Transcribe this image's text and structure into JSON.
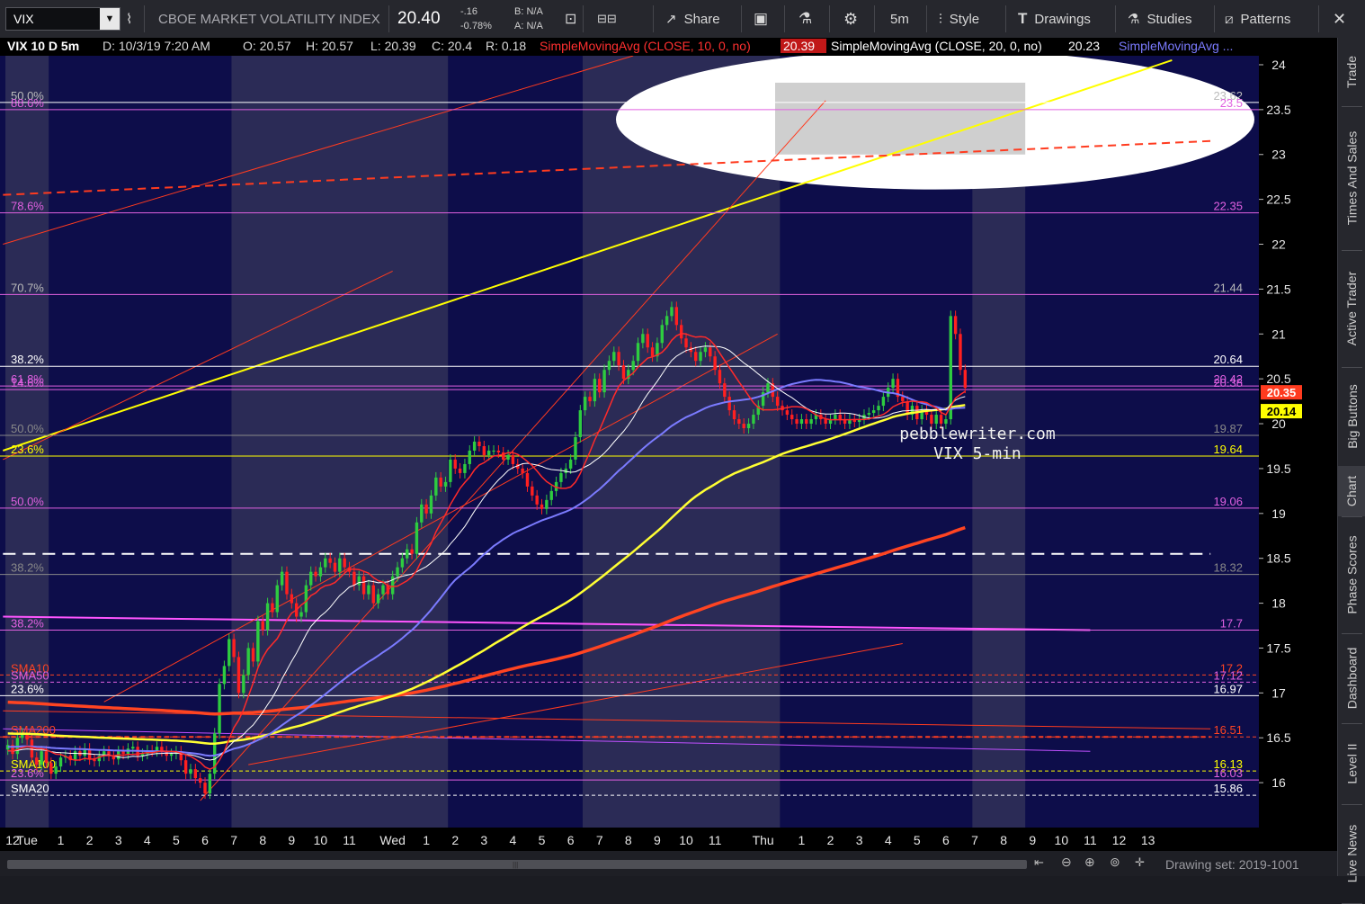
{
  "toolbar": {
    "symbol": "VIX",
    "name": "CBOE MARKET VOLATILITY INDEX",
    "last": "20.40",
    "change": "-.16",
    "change_pct": "-0.78%",
    "bid": "B: N/A",
    "ask": "A: N/A",
    "share": "Share",
    "timeframe": "5m",
    "style": "Style",
    "drawings": "Drawings",
    "studies": "Studies",
    "patterns": "Patterns"
  },
  "info": {
    "title": "VIX 10 D 5m",
    "date": "D: 10/3/19 7:20 AM",
    "open": "O: 20.57",
    "high": "H: 20.57",
    "low": "L: 20.39",
    "close": "C: 20.4",
    "range": "R: 0.18",
    "sma1": "SimpleMovingAvg (CLOSE, 10, 0, no)",
    "sma1_val": "20.39",
    "sma2": "SimpleMovingAvg (CLOSE, 20, 0, no)",
    "sma2_val": "20.23",
    "sma3": "SimpleMovingAvg ..."
  },
  "rightnav": [
    "Trade",
    "Times And Sales",
    "Active Trader",
    "Big Buttons",
    "Chart",
    "Phase Scores",
    "Dashboard",
    "Level II",
    "Live News"
  ],
  "watermark": {
    "line1": "pebblewriter.com",
    "line2": "VIX 5-min"
  },
  "bottom": {
    "drawing_set": "Drawing set: 2019-1001"
  },
  "chart_data": {
    "type": "candlestick",
    "symbol": "VIX",
    "interval": "5m",
    "ylim": [
      15.5,
      24.1
    ],
    "y_ticks": [
      16,
      16.5,
      17,
      17.5,
      18,
      18.5,
      19,
      19.5,
      20,
      20.5,
      21,
      21.5,
      22,
      22.5,
      23,
      23.5,
      24
    ],
    "x_ticks": [
      {
        "i": 1,
        "label": "12"
      },
      {
        "i": 4,
        "label": "Tue"
      },
      {
        "i": 11,
        "label": "1"
      },
      {
        "i": 17,
        "label": "2"
      },
      {
        "i": 23,
        "label": "3"
      },
      {
        "i": 29,
        "label": "4"
      },
      {
        "i": 35,
        "label": "5"
      },
      {
        "i": 41,
        "label": "6"
      },
      {
        "i": 47,
        "label": "7"
      },
      {
        "i": 53,
        "label": "8"
      },
      {
        "i": 59,
        "label": "9"
      },
      {
        "i": 65,
        "label": "10"
      },
      {
        "i": 71,
        "label": "11"
      },
      {
        "i": 80,
        "label": "Wed"
      },
      {
        "i": 87,
        "label": "1"
      },
      {
        "i": 93,
        "label": "2"
      },
      {
        "i": 99,
        "label": "3"
      },
      {
        "i": 105,
        "label": "4"
      },
      {
        "i": 111,
        "label": "5"
      },
      {
        "i": 117,
        "label": "6"
      },
      {
        "i": 123,
        "label": "7"
      },
      {
        "i": 129,
        "label": "8"
      },
      {
        "i": 135,
        "label": "9"
      },
      {
        "i": 141,
        "label": "10"
      },
      {
        "i": 147,
        "label": "11"
      },
      {
        "i": 157,
        "label": "Thu"
      },
      {
        "i": 165,
        "label": "1"
      },
      {
        "i": 171,
        "label": "2"
      },
      {
        "i": 177,
        "label": "3"
      },
      {
        "i": 183,
        "label": "4"
      },
      {
        "i": 189,
        "label": "5"
      },
      {
        "i": 195,
        "label": "6"
      },
      {
        "i": 201,
        "label": "7"
      },
      {
        "i": 207,
        "label": "8"
      },
      {
        "i": 213,
        "label": "9"
      },
      {
        "i": 219,
        "label": "10"
      },
      {
        "i": 225,
        "label": "11"
      },
      {
        "i": 231,
        "label": "12"
      },
      {
        "i": 237,
        "label": "13"
      }
    ],
    "sessions_shaded": [
      [
        0,
        9
      ],
      [
        47,
        92
      ],
      [
        120,
        161
      ],
      [
        201,
        212
      ]
    ],
    "close": [
      16.42,
      16.32,
      16.5,
      16.55,
      16.48,
      16.28,
      16.2,
      16.35,
      16.22,
      16.1,
      16.18,
      16.28,
      16.3,
      16.25,
      16.35,
      16.3,
      16.38,
      16.26,
      16.24,
      16.3,
      16.35,
      16.3,
      16.26,
      16.35,
      16.32,
      16.38,
      16.4,
      16.3,
      16.32,
      16.36,
      16.35,
      16.4,
      16.35,
      16.3,
      16.32,
      16.35,
      16.25,
      16.1,
      16.15,
      16.05,
      16.0,
      15.88,
      16.1,
      16.55,
      17.1,
      17.3,
      17.6,
      17.4,
      17.0,
      17.2,
      17.5,
      17.35,
      17.8,
      17.7,
      18.0,
      17.9,
      18.2,
      18.35,
      18.1,
      18.0,
      17.85,
      17.9,
      18.2,
      18.35,
      18.3,
      18.4,
      18.5,
      18.45,
      18.35,
      18.5,
      18.4,
      18.35,
      18.2,
      18.3,
      18.1,
      18.2,
      18.0,
      18.1,
      18.2,
      18.1,
      18.3,
      18.4,
      18.5,
      18.6,
      18.55,
      18.9,
      19.1,
      19.0,
      19.2,
      19.4,
      19.3,
      19.35,
      19.6,
      19.5,
      19.45,
      19.55,
      19.7,
      19.8,
      19.75,
      19.65,
      19.7,
      19.7,
      19.68,
      19.6,
      19.65,
      19.55,
      19.5,
      19.45,
      19.3,
      19.2,
      19.1,
      19.05,
      19.15,
      19.25,
      19.35,
      19.45,
      19.5,
      19.6,
      19.85,
      20.15,
      20.3,
      20.25,
      20.5,
      20.35,
      20.6,
      20.7,
      20.8,
      20.65,
      20.5,
      20.6,
      20.7,
      20.9,
      21.0,
      20.85,
      20.75,
      20.9,
      21.1,
      21.2,
      21.3,
      21.1,
      20.95,
      20.85,
      20.8,
      20.7,
      20.8,
      20.85,
      20.75,
      20.6,
      20.45,
      20.3,
      20.15,
      20.05,
      20.0,
      19.95,
      20.0,
      20.1,
      20.2,
      20.35,
      20.45,
      20.3,
      20.2,
      20.15,
      20.1,
      20.05,
      20.0,
      20.05,
      20.0,
      20.05,
      20.1,
      20.05,
      20.0,
      20.05,
      20.1,
      20.05,
      20.0,
      20.05,
      20.02,
      20.05,
      20.1,
      20.12,
      20.15,
      20.2,
      20.3,
      20.4,
      20.5,
      20.3,
      20.25,
      20.1,
      20.2,
      20.05,
      20.15,
      20.1,
      20.0,
      20.1,
      20.0,
      20.05,
      21.2,
      21.0,
      20.6,
      20.4
    ]
  },
  "levels": [
    {
      "y": 23.58,
      "color": "#ffffff",
      "left": "50.0%",
      "right": "23.62",
      "right_color": "#bbbbbb",
      "left_color": "#bbbbbb"
    },
    {
      "y": 23.5,
      "color": "#e060e0",
      "left": "88.6%",
      "right": "23.5",
      "right_color": "#e060e0",
      "left_color": "#e060e0"
    },
    {
      "y": 22.35,
      "color": "#e060e0",
      "left": "78.6%",
      "right": "22.35",
      "right_color": "#e060e0",
      "left_color": "#e060e0"
    },
    {
      "y": 21.44,
      "color": "#e060e0",
      "left": "70.7%",
      "right": "21.44",
      "right_color": "#bbbbbb",
      "left_color": "#bbbbbb"
    },
    {
      "y": 20.64,
      "color": "#ffffff",
      "left": "38.2%",
      "right": "20.64",
      "right_color": "#ffffff",
      "left_color": "#ffffff"
    },
    {
      "y": 20.42,
      "color": "#e060e0",
      "left": "61.8%",
      "right": "20.42",
      "right_color": "#e060e0",
      "left_color": "#e060e0"
    },
    {
      "y": 20.38,
      "color": "#e060e0",
      "left": "14.6%",
      "right": "20.38",
      "right_color": "#e060e0",
      "left_color": "#e060e0"
    },
    {
      "y": 19.87,
      "color": "#888888",
      "left": "50.0%",
      "right": "19.87",
      "right_color": "#888888",
      "left_color": "#888888"
    },
    {
      "y": 19.64,
      "color": "#ffff00",
      "left": "23.6%",
      "right": "19.64",
      "right_color": "#ffff00",
      "left_color": "#ffff00"
    },
    {
      "y": 19.06,
      "color": "#e060e0",
      "left": "50.0%",
      "right": "19.06",
      "right_color": "#e060e0",
      "left_color": "#e060e0"
    },
    {
      "y": 18.32,
      "color": "#888888",
      "left": "38.2%",
      "right": "18.32",
      "right_color": "#888888",
      "left_color": "#888888"
    },
    {
      "y": 17.7,
      "color": "#e060e0",
      "left": "38.2%",
      "right": "17.7",
      "right_color": "#e060e0",
      "left_color": "#e060e0"
    },
    {
      "y": 17.2,
      "color": "#ff4422",
      "left": "SMA10",
      "right": "17.2",
      "right_color": "#ff4422",
      "left_color": "#ff4422",
      "dash": true
    },
    {
      "y": 17.12,
      "color": "#e060e0",
      "left": "SMA50",
      "right": "17.12",
      "right_color": "#e060e0",
      "left_color": "#e060e0",
      "dash": true
    },
    {
      "y": 16.97,
      "color": "#ffffff",
      "left": "23.6%",
      "right": "16.97",
      "right_color": "#ffffff",
      "left_color": "#ffffff"
    },
    {
      "y": 16.51,
      "color": "#ff4422",
      "left": "SMA200",
      "right": "16.51",
      "right_color": "#ff4422",
      "left_color": "#ff4422",
      "dash": true
    },
    {
      "y": 16.13,
      "color": "#ffff00",
      "left": "SMA100",
      "right": "16.13",
      "right_color": "#ffff00",
      "left_color": "#ffff00",
      "dash": true
    },
    {
      "y": 16.03,
      "color": "#e060e0",
      "left": "23.6%",
      "right": "16.03",
      "right_color": "#e060e0",
      "left_color": "#e060e0"
    },
    {
      "y": 15.86,
      "color": "#ffffff",
      "left": "SMA20",
      "right": "15.86",
      "right_color": "#ffffff",
      "left_color": "#ffffff",
      "dash": true
    }
  ],
  "price_tags": [
    {
      "y": 20.35,
      "label": "20.35",
      "bg": "#ff3b1f",
      "fg": "#ffffff"
    },
    {
      "y": 20.14,
      "label": "20.14",
      "bg": "#ffff00",
      "fg": "#000000"
    }
  ],
  "colors": {
    "bg": "#0d0d4a",
    "shade": "#2b2b56",
    "sma10": "#ff2a2a",
    "sma20": "#ffffff",
    "sma50": "#7b7bff",
    "sma100": "#ffff33",
    "sma200": "#ff4422"
  }
}
